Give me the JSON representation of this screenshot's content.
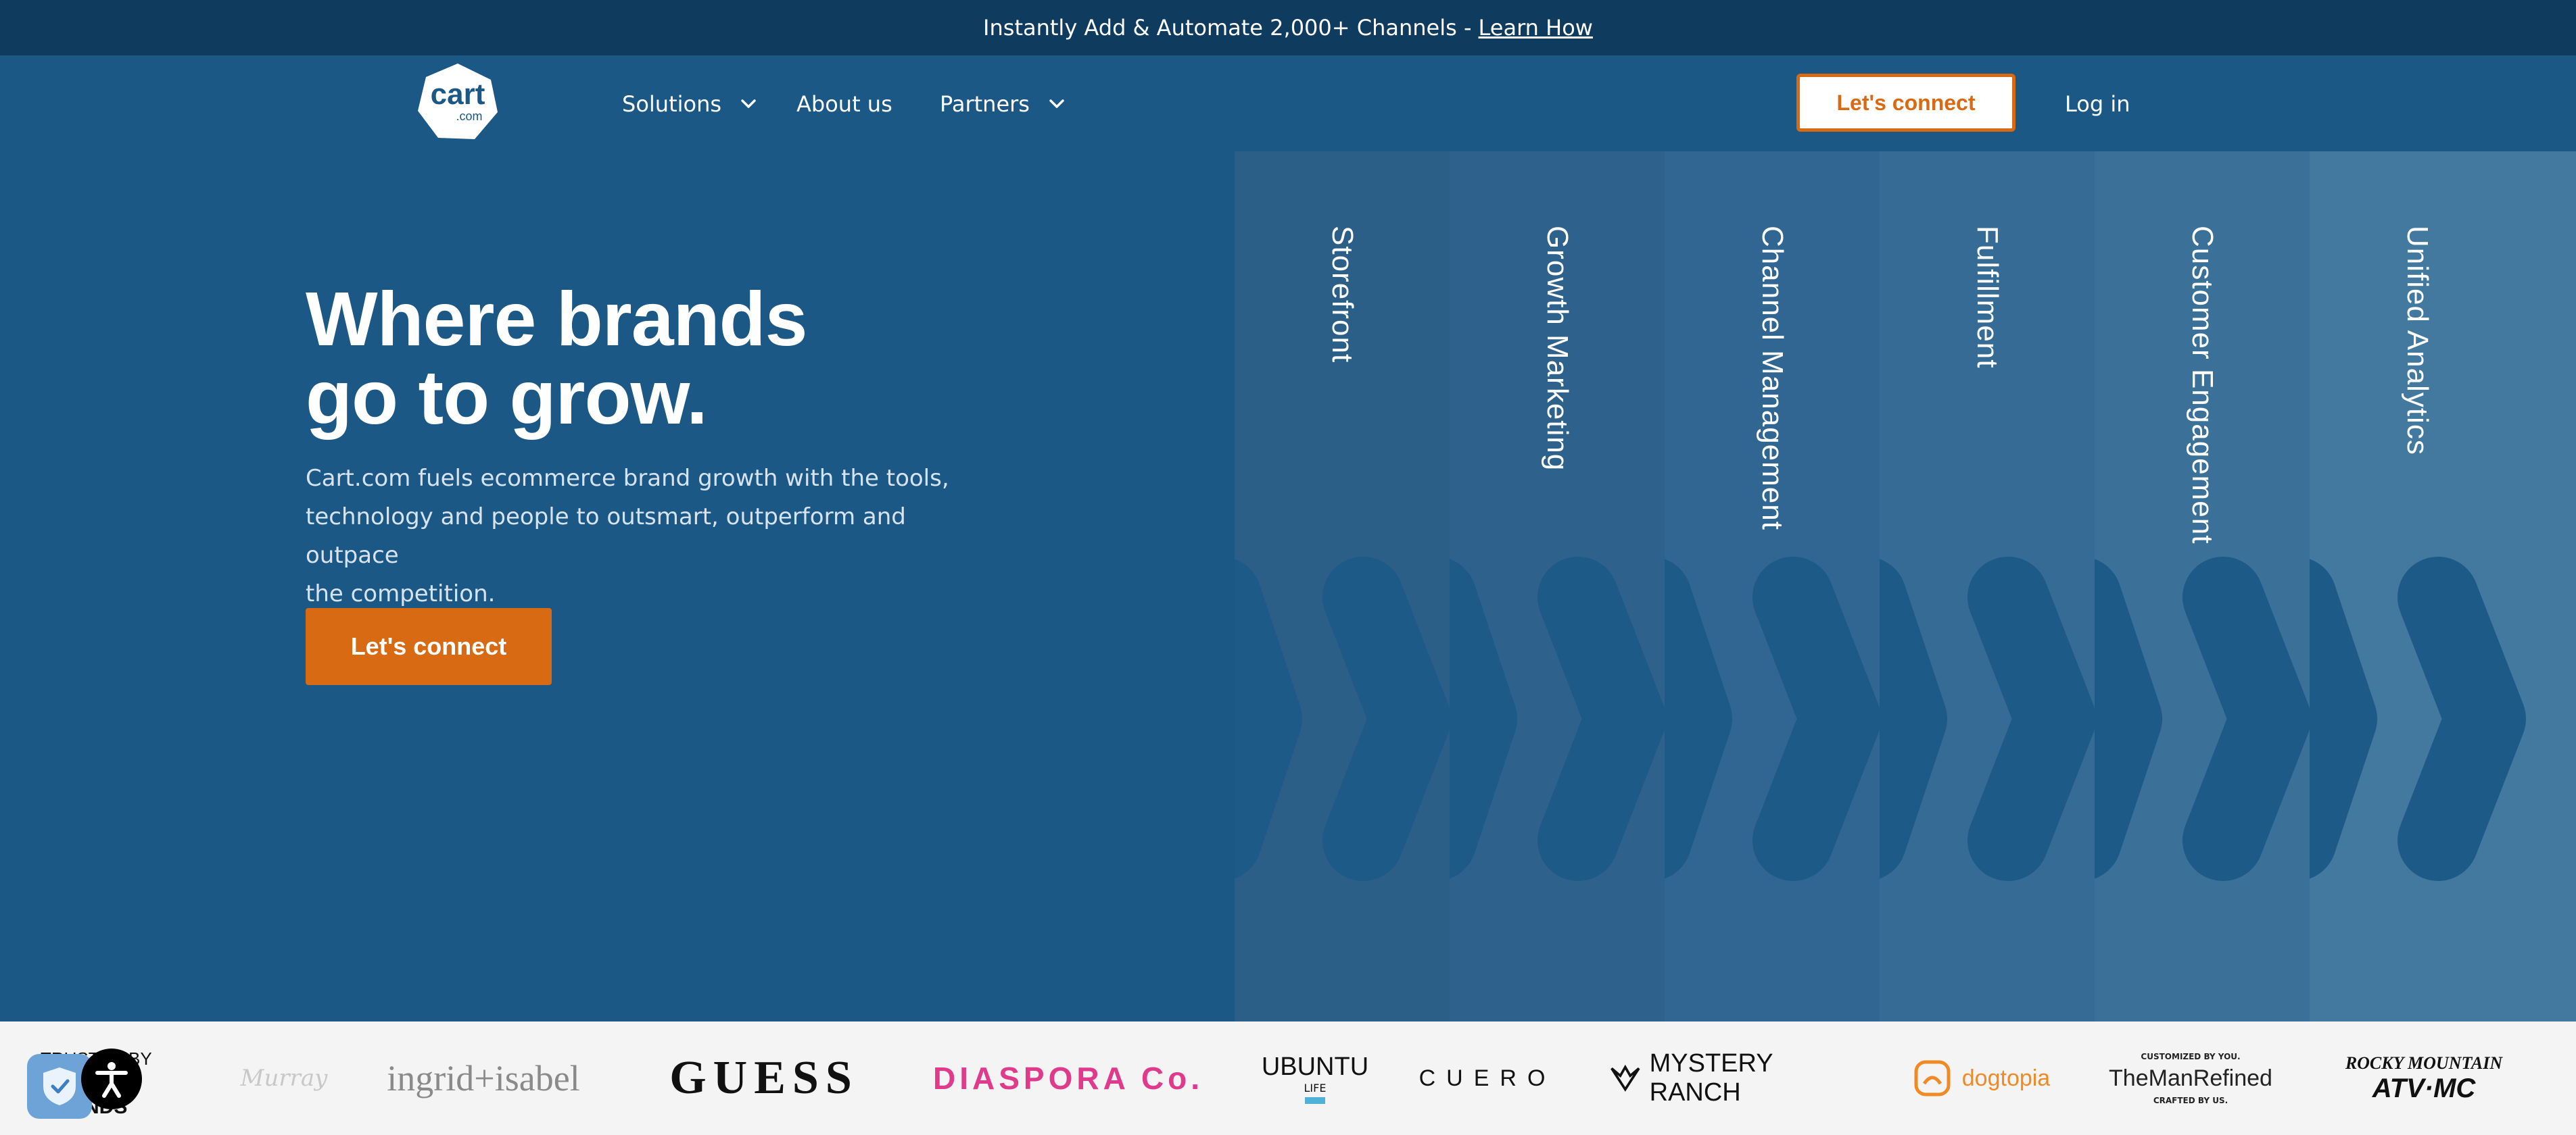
{
  "announcement": {
    "text": "Instantly Add & Automate 2,000+ Channels -",
    "link": "Learn How"
  },
  "nav": {
    "logo_text": "cart",
    "logo_sub": ".com",
    "items": [
      {
        "label": "Solutions",
        "has_dropdown": true
      },
      {
        "label": "About us",
        "has_dropdown": false
      },
      {
        "label": "Partners",
        "has_dropdown": true
      }
    ],
    "cta": "Let's connect",
    "login": "Log in"
  },
  "hero": {
    "title_line1": "Where brands",
    "title_line2": "go to grow.",
    "subtitle_line1": "Cart.com fuels ecommerce brand growth with the tools,",
    "subtitle_line2": "technology and people to outsmart, outperform and outpace",
    "subtitle_line3": "the competition.",
    "cta": "Let's connect"
  },
  "panels": [
    {
      "label": "Storefront",
      "color": "#2b5f88"
    },
    {
      "label": "Growth Marketing",
      "color": "#2e628d"
    },
    {
      "label": "Channel Management",
      "color": "#306691"
    },
    {
      "label": "Fulfillment",
      "color": "#356b95"
    },
    {
      "label": "Customer Engagement",
      "color": "#3b7199"
    },
    {
      "label": "Unified Analytics",
      "color": "#43789f"
    }
  ],
  "trusted": {
    "line1": "TRUSTED BY OVER",
    "line2": "BRANDS"
  },
  "brands": [
    {
      "name": "Murray"
    },
    {
      "name": "ingrid+isabel"
    },
    {
      "name": "GUESS"
    },
    {
      "name": "DIASPORA Co."
    },
    {
      "name": "UBUNTU",
      "sub": "LIFE"
    },
    {
      "name": "CUERO"
    },
    {
      "name": "MYSTERY RANCH"
    },
    {
      "name": "dogtopia"
    },
    {
      "name": "TheManRefined",
      "top": "CUSTOMIZED BY YOU.",
      "bottom": "CRAFTED BY US."
    },
    {
      "name": "ROCKY MOUNTAIN",
      "sub": "ATV·MC"
    }
  ],
  "colors": {
    "accent": "#d96a14",
    "brand_blue": "#1c5886",
    "dark_blue": "#0e3b5e",
    "diaspora": "#e03a8c",
    "dogtopia": "#f08a24"
  }
}
